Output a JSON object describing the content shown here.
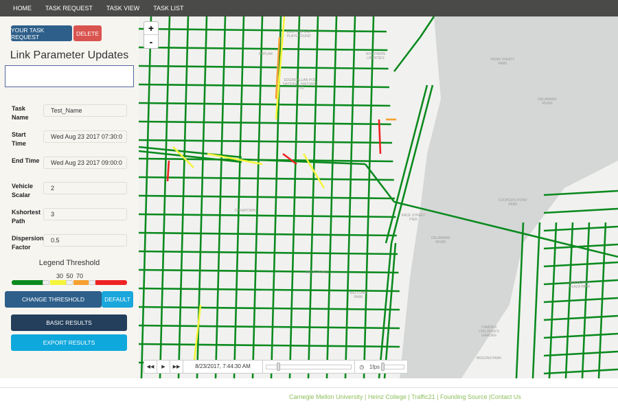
{
  "nav": [
    "HOME",
    "TASK REQUEST",
    "TASK VIEW",
    "TASK LIST"
  ],
  "side": {
    "your_task_request": "YOUR TASK REQUEST",
    "delete": "DELETE",
    "title": "Link Parameter Updates",
    "fields": [
      {
        "label": "Task Name",
        "value": "Test_Name"
      },
      {
        "label": "Start Time",
        "value": "Wed Aug 23 2017 07:30:0"
      },
      {
        "label": "End Time",
        "value": "Wed Aug 23 2017 09:00:0"
      },
      {
        "label": "Vehicle Scalar",
        "value": "2"
      },
      {
        "label": "Kshortest Path",
        "value": "3"
      },
      {
        "label": "Dispersion Factor",
        "value": "0.5"
      }
    ],
    "legend_title": "Legend Threshold",
    "thresholds": "30 50 70",
    "threshold_values": [
      30,
      50,
      70
    ],
    "legend_colors": [
      "#0a8a1e",
      "#f5f53a",
      "#f5a030",
      "#ee2222"
    ],
    "change_threshold": "CHANGE THRESHOLD",
    "default": "DEFAULT",
    "basic_results": "BASIC RESULTS",
    "export_results": "EXPORT RESULTS"
  },
  "map": {
    "zoom_in": "+",
    "zoom_out": "-",
    "labels": [
      "East Poplar Playground",
      "Poplar",
      "Northern Liberties",
      "Edgar Allan Poe National Historic Site",
      "Penn Treaty Park",
      "Delaware River",
      "Chinatown",
      "Cooper's Point Park",
      "Welcome Park",
      "Society Hill",
      "Camden Children's Garden",
      "Roosevelt Plaza Park",
      "Wiggins Park",
      "Race Street Pier",
      "Delaware River"
    ],
    "road_color": "#0a8a1e"
  },
  "player": {
    "timestamp": "8/23/2017, 7:44:30 AM",
    "fps": "1fps",
    "rewind": "rewind-icon",
    "play": "play-icon",
    "forward": "fast-forward-icon"
  },
  "footer": [
    "Carnegie Mellon University",
    "Heinz College",
    "Traffic21",
    "Founding Source",
    "Contact Us"
  ]
}
